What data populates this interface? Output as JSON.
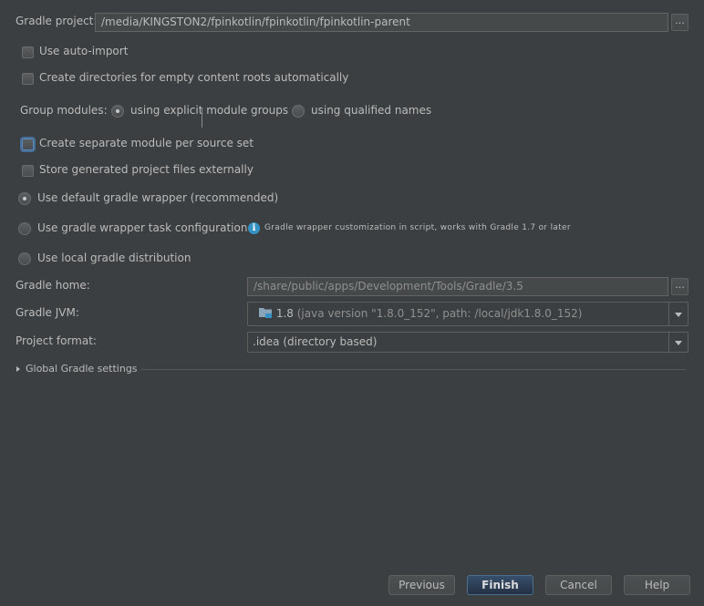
{
  "gradle_project": {
    "label": "Gradle project:",
    "path": "/media/KINGSTON2/fpinkotlin/fpinkotlin/fpinkotlin-parent",
    "browse_label": "..."
  },
  "options": {
    "auto_import": "Use auto-import",
    "create_dirs": "Create directories for empty content roots automatically",
    "separate_module": "Create separate module per source set",
    "store_external": "Store generated project files externally"
  },
  "group_modules": {
    "label": "Group modules:",
    "explicit": "using explicit module groups",
    "qualified": "using qualified names"
  },
  "wrapper": {
    "default": "Use default gradle wrapper (recommended)",
    "task_config": "Use gradle wrapper task configuration",
    "info": "Gradle wrapper customization in script, works with Gradle 1.7 or later",
    "local": "Use local gradle distribution"
  },
  "gradle_home": {
    "label": "Gradle home:",
    "path": "/share/public/apps/Development/Tools/Gradle/3.5",
    "browse_label": "..."
  },
  "gradle_jvm": {
    "label": "Gradle JVM:",
    "version": "1.8",
    "detail": "(java version \"1.8.0_152\", path: /local/jdk1.8.0_152)"
  },
  "project_format": {
    "label": "Project format:",
    "value": ".idea (directory based)"
  },
  "global_settings": {
    "label": "Global Gradle settings"
  },
  "footer": {
    "previous": "Previous",
    "finish": "Finish",
    "cancel": "Cancel",
    "help": "Help"
  },
  "colors": {
    "background": "#3c3f41",
    "text": "#bbbbbb",
    "accent": "#3592c4"
  }
}
